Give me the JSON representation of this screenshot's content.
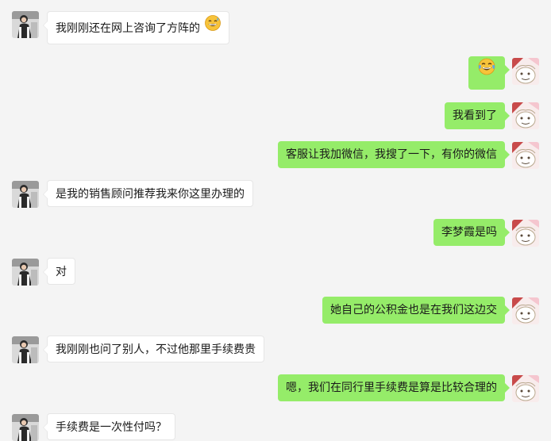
{
  "chat": {
    "messages": [
      {
        "side": "left",
        "text": "我刚刚还在网上咨询了方阵的",
        "emoji": "grinning-sweat-emoji"
      },
      {
        "side": "right",
        "text": "",
        "emoji": "tears-of-joy-emoji"
      },
      {
        "side": "right",
        "text": "我看到了"
      },
      {
        "side": "right",
        "text": "客服让我加微信，我搜了一下，有你的微信"
      },
      {
        "side": "left",
        "text": "是我的销售顾问推荐我来你这里办理的"
      },
      {
        "side": "right",
        "text": "李梦霞是吗"
      },
      {
        "side": "left",
        "text": "对"
      },
      {
        "side": "right",
        "text": "她自己的公积金也是在我们这边交"
      },
      {
        "side": "left",
        "text": "我刚刚也问了别人，不过他那里手续费贵"
      },
      {
        "side": "right",
        "text": "嗯，我们在同行里手续费是算是比较合理的"
      },
      {
        "side": "left",
        "text": "手续费是一次性付吗？"
      }
    ]
  },
  "colors": {
    "background": "#f4f4f4",
    "sent_bubble": "#95ec69",
    "received_bubble": "#ffffff"
  }
}
